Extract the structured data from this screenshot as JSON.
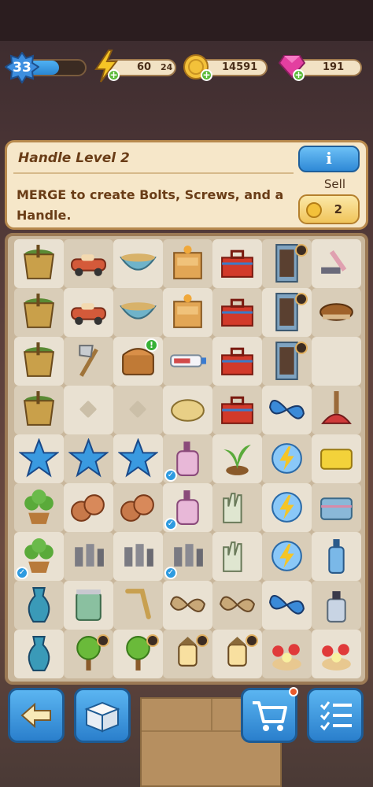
{
  "header": {
    "level": "33",
    "xp_progress": 0.55,
    "energy_current": "60",
    "energy_timer": "24",
    "coins": "14591",
    "gems": "191"
  },
  "info": {
    "title": "Handle Level 2",
    "description": "MERGE to create Bolts, Screws, and a Handle.",
    "info_button_label": "i",
    "sell_label": "Sell",
    "sell_value": "2"
  },
  "board": {
    "rows": 9,
    "cols": 7,
    "items": [
      [
        "bucket-icon",
        "toy-car-icon",
        "bowl-icon",
        "nightstand-icon",
        "toolbox-icon",
        "wardrobe-icon",
        "squeegee-icon"
      ],
      [
        "bucket-icon",
        "toy-car-icon",
        "bowl-icon",
        "nightstand-icon",
        "toolbox-icon",
        "wardrobe-icon",
        "brush-icon"
      ],
      [
        "bucket-icon",
        "axe-icon",
        "chest-icon",
        "toothpaste-icon",
        "toolbox-icon",
        "wardrobe-icon",
        "spray-bottle-icon"
      ],
      [
        "bucket-icon",
        "",
        "",
        "soap-bar-icon",
        "toolbox-icon",
        "butterfly-icon",
        "plunger-icon"
      ],
      [
        "star-icon",
        "star-icon",
        "star-icon",
        "soap-dispenser-icon",
        "sprout-icon",
        "energy-orb-icon",
        "sponge-icon"
      ],
      [
        "potted-plant-icon",
        "coins-icon",
        "coins-icon",
        "soap-dispenser-icon",
        "gloves-icon",
        "energy-orb-icon",
        "towel-icon"
      ],
      [
        "potted-plant-icon",
        "screws-icon",
        "screws-icon",
        "screws-icon",
        "gloves-icon",
        "energy-orb-icon",
        "bottle-icon"
      ],
      [
        "vase-icon",
        "jar-icon",
        "handle-icon",
        "moth-icon",
        "moth-icon",
        "butterfly-icon",
        "perfume-icon"
      ],
      [
        "vase-icon",
        "tree-icon",
        "tree-icon",
        "lantern-icon",
        "lantern-icon",
        "flowers-icon",
        "flowers-icon"
      ]
    ]
  },
  "bottom_nav": {
    "back_icon": "back-arrow-icon",
    "inventory_icon": "box-icon",
    "shop_icon": "cart-icon",
    "tasks_icon": "checklist-icon"
  },
  "colors": {
    "accent_blue": "#2f89d6",
    "panel_bg": "#f6e7c9",
    "text_brown": "#6a3d17",
    "plus_green": "#5dbb3b"
  }
}
